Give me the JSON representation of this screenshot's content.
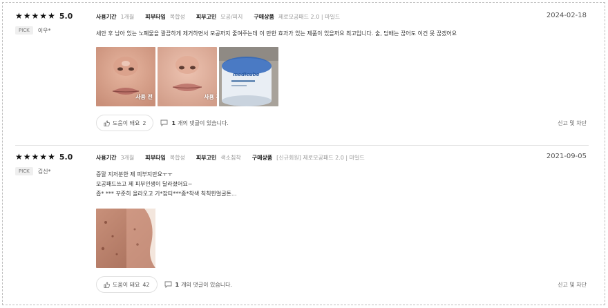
{
  "reviews": [
    {
      "rating": "5.0",
      "pick": "PICK",
      "user": "이우*",
      "meta": [
        {
          "key": "사용기간",
          "value": "1개월"
        },
        {
          "key": "피부타입",
          "value": "복합성"
        },
        {
          "key": "피부고민",
          "value": "모공/피지"
        },
        {
          "key": "구매상품",
          "value": "제로모공패드 2.0 | 마일드"
        }
      ],
      "date": "2024-02-18",
      "text": [
        "세안 후 남아 있는 노폐물을 깔끔하게 제거하면서 모공까지 줄여주는데 이 만한 효과가 있는 제품이 있을까요 최고입니다. 술, 담배는 끊어도 이건 못 끊겠어요"
      ],
      "photo_tags": [
        "사용 전",
        "사용 후",
        ""
      ],
      "jar_brand": "medicube",
      "help_label": "도움이 돼요",
      "help_count": "2",
      "comment_count": "1",
      "comment_text": "개의 댓글이 있습니다.",
      "report_label": "신고 및 차단"
    },
    {
      "rating": "5.0",
      "pick": "PICK",
      "user": "김신*",
      "meta": [
        {
          "key": "사용기간",
          "value": "3개월"
        },
        {
          "key": "피부타입",
          "value": "복합성"
        },
        {
          "key": "피부고민",
          "value": "색소침착"
        },
        {
          "key": "구매상품",
          "value": "[신규회원] 제로모공패드 2.0 | 마일드"
        }
      ],
      "date": "2021-09-05",
      "text": [
        "증말 지저분한 제 피부지만요ㅜㅜ",
        "모공패드쓰고 제 피부인생이 달라졌어요~",
        "좁* *** 꾸준히 올라오고 기*잡티***좀*착색 칙칙한얼굴톤..."
      ],
      "help_label": "도움이 돼요",
      "help_count": "42",
      "comment_count": "1",
      "comment_text": "개의 댓글이 있습니다.",
      "report_label": "신고 및 차단"
    }
  ]
}
